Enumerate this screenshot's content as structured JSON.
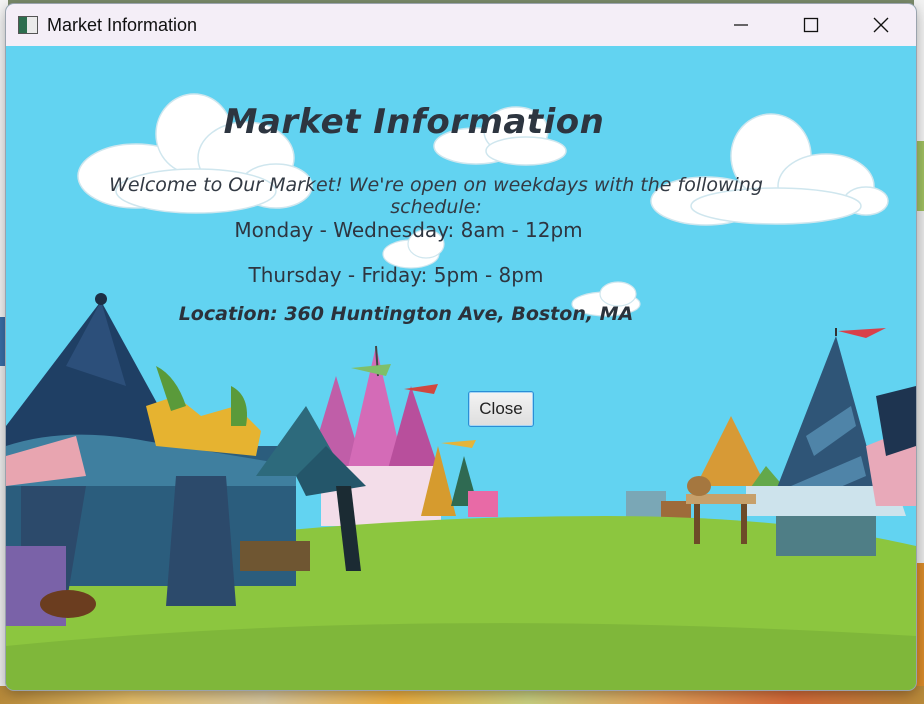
{
  "window": {
    "title": "Market Information",
    "controls": [
      "minimize",
      "maximize",
      "close"
    ]
  },
  "main": {
    "heading": "Market Information",
    "welcome": "Welcome to Our Market! We're open on weekdays with the following schedule:",
    "schedule": [
      "Monday - Wednesday: 8am - 12pm",
      "Thursday - Friday: 5pm - 8pm"
    ],
    "location": "Location: 360 Huntington Ave, Boston, MA",
    "close_label": "Close"
  },
  "colors": {
    "sky": "#62d3f1",
    "grass": "#8cc63f",
    "titlebar": "#f4eef7",
    "button_border": "#2a8ed6"
  }
}
